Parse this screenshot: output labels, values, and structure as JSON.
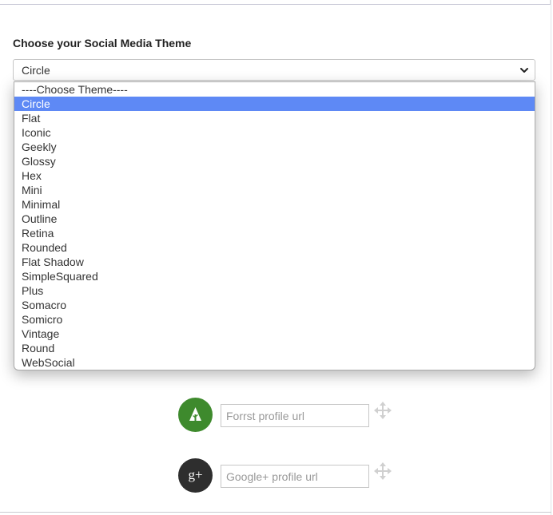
{
  "section": {
    "title": "Choose your Social Media Theme"
  },
  "theme_select": {
    "selected": "Circle",
    "options": [
      "----Choose Theme----",
      "Circle",
      "Flat",
      "Iconic",
      "Geekly",
      "Glossy",
      "Hex",
      "Mini",
      "Minimal",
      "Outline",
      "Retina",
      "Rounded",
      "Flat Shadow",
      "SimpleSquared",
      "Plus",
      "Somacro",
      "Somicro",
      "Vintage",
      "Round",
      "WebSocial"
    ],
    "highlighted_index": 1
  },
  "social_links": [
    {
      "network": "Forrst",
      "icon": "forrst-tree-icon",
      "color": "#3e8a2d",
      "placeholder": "Forrst profile url",
      "value": ""
    },
    {
      "network": "Google+",
      "icon": "google-plus-icon",
      "color": "#2e2e2e",
      "glyph": "g+",
      "placeholder": "Google+ profile url",
      "value": ""
    }
  ],
  "colors": {
    "highlight": "#5e89f5",
    "move_icon": "#d0d0d0"
  }
}
